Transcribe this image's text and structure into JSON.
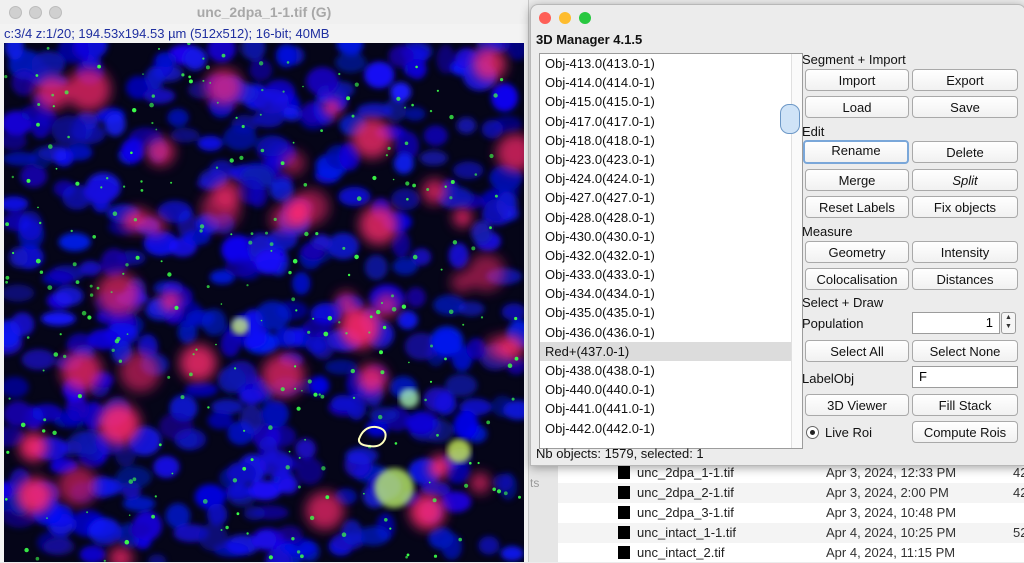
{
  "image_window": {
    "title": "unc_2dpa_1-1.tif (G)",
    "info": "c:3/4 z:1/20; 194.53x194.53 µm (512x512); 16-bit; 40MB"
  },
  "manager": {
    "title": "3D Manager 4.1.5",
    "list_items": [
      "Obj-413.0(413.0-1)",
      "Obj-414.0(414.0-1)",
      "Obj-415.0(415.0-1)",
      "Obj-417.0(417.0-1)",
      "Obj-418.0(418.0-1)",
      "Obj-423.0(423.0-1)",
      "Obj-424.0(424.0-1)",
      "Obj-427.0(427.0-1)",
      "Obj-428.0(428.0-1)",
      "Obj-430.0(430.0-1)",
      "Obj-432.0(432.0-1)",
      "Obj-433.0(433.0-1)",
      "Obj-434.0(434.0-1)",
      "Obj-435.0(435.0-1)",
      "Obj-436.0(436.0-1)",
      "Red+(437.0-1)",
      "Obj-438.0(438.0-1)",
      "Obj-440.0(440.0-1)",
      "Obj-441.0(441.0-1)",
      "Obj-442.0(442.0-1)"
    ],
    "selected_index": 15,
    "sections": {
      "segment_import": "Segment + Import",
      "edit": "Edit",
      "measure": "Measure",
      "select_draw": "Select + Draw"
    },
    "buttons": {
      "import": "Import",
      "export": "Export",
      "load": "Load",
      "save": "Save",
      "rename": "Rename",
      "delete": "Delete",
      "merge": "Merge",
      "split": "Split",
      "reset_labels": "Reset Labels",
      "fix_objects": "Fix objects",
      "geometry": "Geometry",
      "intensity": "Intensity",
      "colocalisation": "Colocalisation",
      "distances": "Distances",
      "select_all": "Select All",
      "select_none": "Select None",
      "viewer_3d": "3D Viewer",
      "fill_stack": "Fill Stack",
      "compute_rois": "Compute Rois"
    },
    "population_label": "Population",
    "population_value": "1",
    "labelobj_label": "LabelObj",
    "labelobj_value": "F",
    "live_roi_label": "Live Roi",
    "status": "Nb objects: 1579, selected: 1"
  },
  "finder": {
    "sidebar_text": "ts",
    "files": [
      {
        "name": "unc_2dpa_1-1.tif",
        "date": "Apr 3, 2024, 12:33 PM",
        "size": "42"
      },
      {
        "name": "unc_2dpa_2-1.tif",
        "date": "Apr 3, 2024, 2:00 PM",
        "size": "42"
      },
      {
        "name": "unc_2dpa_3-1.tif",
        "date": "Apr 3, 2024, 10:48 PM",
        "size": ""
      },
      {
        "name": "unc_intact_1-1.tif",
        "date": "Apr 4, 2024, 10:25 PM",
        "size": "52"
      },
      {
        "name": "unc_intact_2.tif",
        "date": "Apr 4, 2024, 11:15 PM",
        "size": ""
      }
    ]
  },
  "colors": {
    "nuclei": "#1a1ae0",
    "red_signal": "#ff2a6e",
    "green_signal": "#3cff4a",
    "info_text": "#1f2fa0",
    "focus_ring": "#7aa7d9"
  }
}
